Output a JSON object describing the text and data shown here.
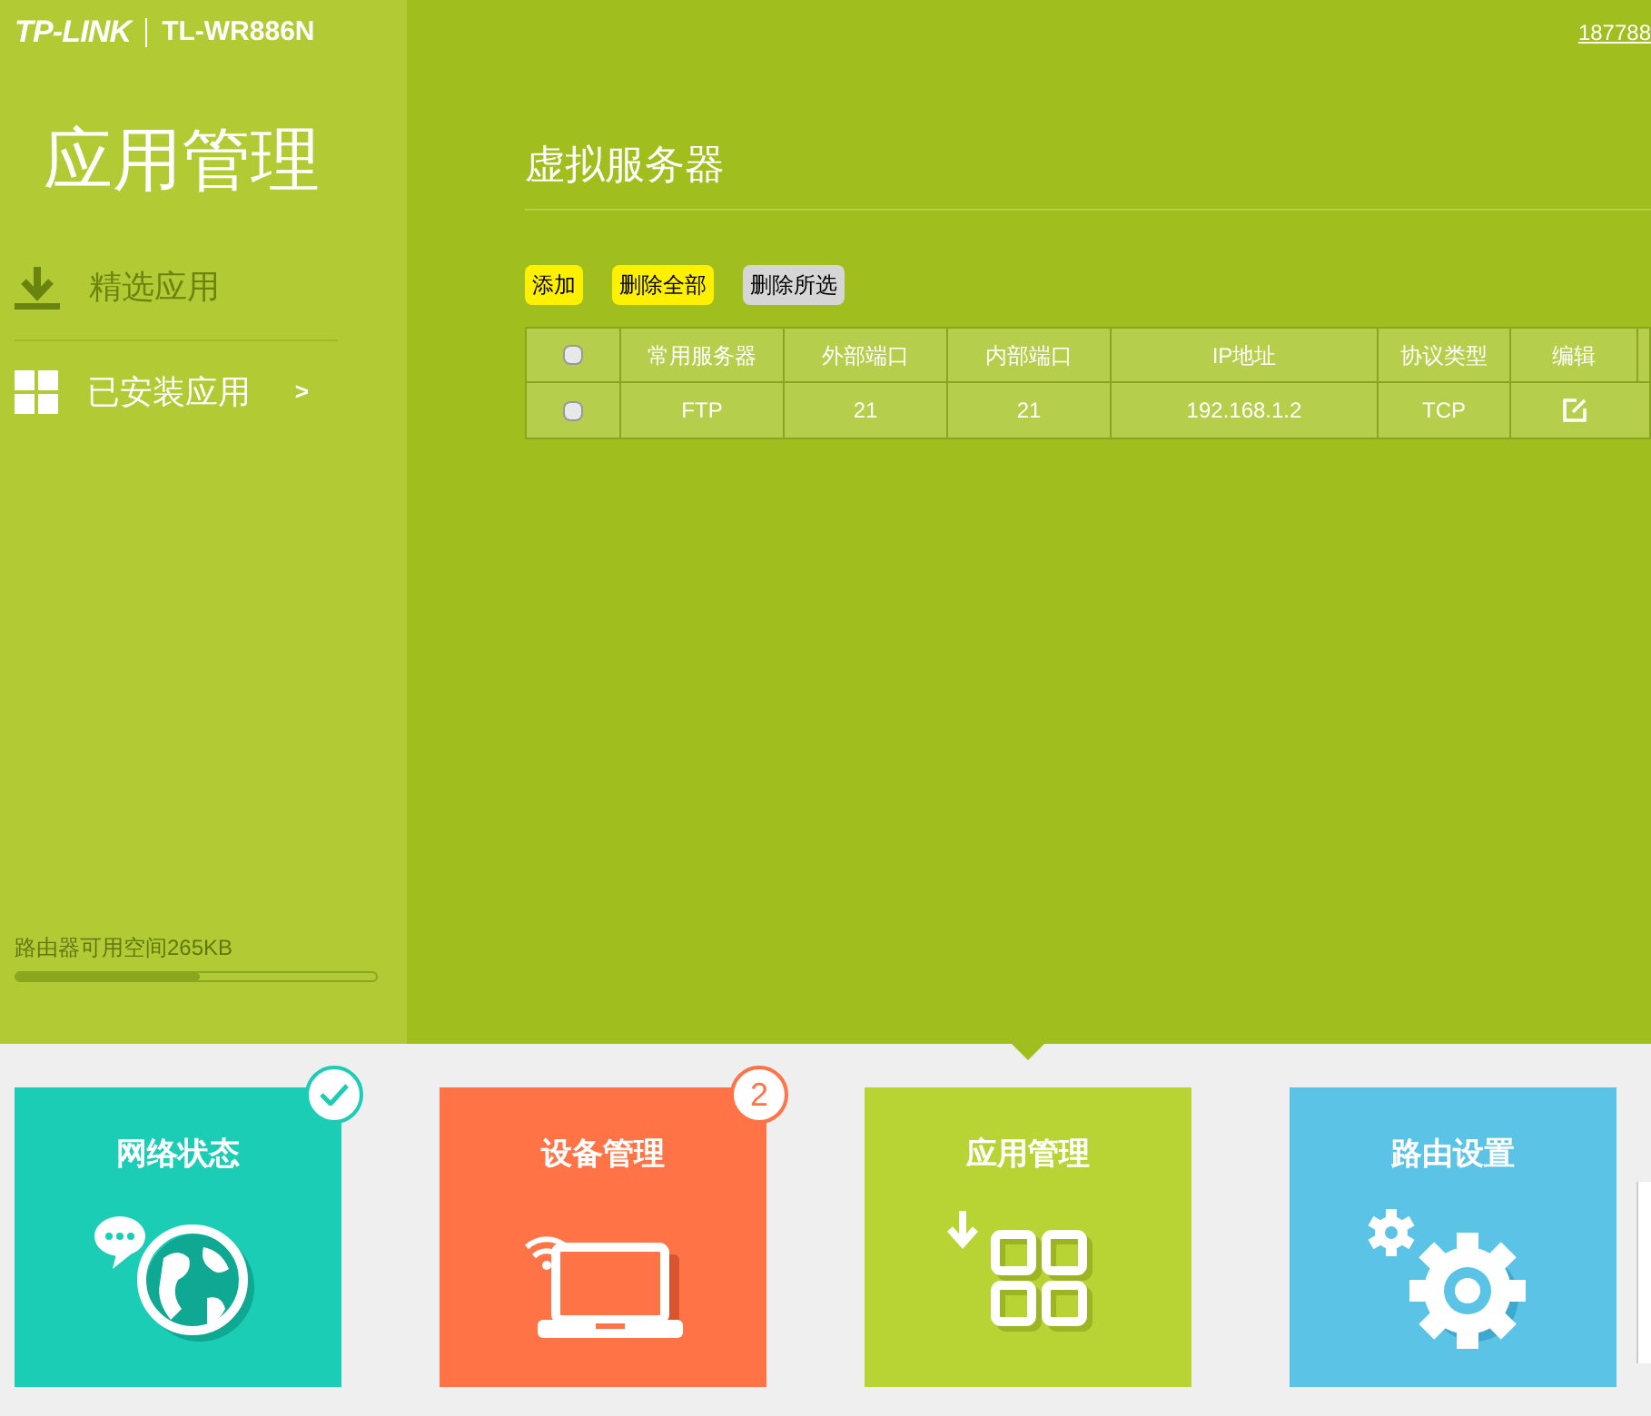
{
  "header": {
    "logo": "TP-LINK",
    "model": "TL-WR886N",
    "account": "187788"
  },
  "sidebar": {
    "title": "应用管理",
    "items": [
      {
        "label": "精选应用",
        "kind": "download",
        "selected": false
      },
      {
        "label": "已安装应用",
        "kind": "grid",
        "selected": true,
        "arrow": ">"
      }
    ],
    "storage": {
      "label": "路由器可用空间265KB",
      "level": 0.51
    }
  },
  "main": {
    "title": "虚拟服务器",
    "buttons": [
      {
        "label": "添加",
        "disabled": false
      },
      {
        "label": "删除全部",
        "disabled": false
      },
      {
        "label": "删除所选",
        "disabled": true
      }
    ],
    "table": {
      "columns": [
        "常用服务器",
        "外部端口",
        "内部端口",
        "IP地址",
        "协议类型",
        "编辑"
      ],
      "header_checked": false,
      "rows": [
        {
          "checked": false,
          "cells": [
            "FTP",
            "21",
            "21",
            "192.168.1.2",
            "TCP"
          ]
        }
      ]
    }
  },
  "tiles": [
    {
      "label": "网络状态",
      "kind": "network",
      "color": "#1ccdb5",
      "selected": false,
      "checked": true
    },
    {
      "label": "设备管理",
      "kind": "devices",
      "color": "#ff7346",
      "selected": false,
      "checked": false,
      "badge": "2"
    },
    {
      "label": "应用管理",
      "kind": "apps",
      "color": "#b8d334",
      "selected": true,
      "checked": false
    },
    {
      "label": "路由设置",
      "kind": "settings",
      "color": "#5bc4e6",
      "selected": false,
      "checked": false
    }
  ]
}
